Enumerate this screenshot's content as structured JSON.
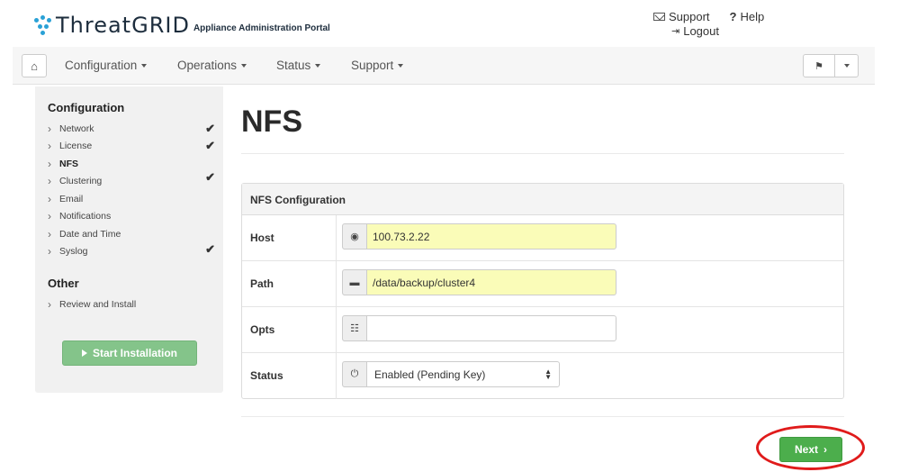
{
  "header": {
    "brand": "ThreatGRID",
    "brand_sub": "Appliance Administration Portal",
    "support_label": "Support",
    "help_label": "Help",
    "logout_label": "Logout"
  },
  "navbar": {
    "items": [
      {
        "label": "Configuration"
      },
      {
        "label": "Operations"
      },
      {
        "label": "Status"
      },
      {
        "label": "Support"
      }
    ]
  },
  "sidebar": {
    "section1_title": "Configuration",
    "items": [
      {
        "label": "Network",
        "checked": true
      },
      {
        "label": "License",
        "checked": true
      },
      {
        "label": "NFS",
        "checked": false,
        "active": true
      },
      {
        "label": "Clustering",
        "checked": true
      },
      {
        "label": "Email",
        "checked": false
      },
      {
        "label": "Notifications",
        "checked": false
      },
      {
        "label": "Date and Time",
        "checked": false
      },
      {
        "label": "Syslog",
        "checked": true
      }
    ],
    "section2_title": "Other",
    "other_items": [
      {
        "label": "Review and Install"
      }
    ],
    "start_button_label": "Start Installation"
  },
  "main": {
    "page_title": "NFS",
    "panel_title": "NFS Configuration",
    "fields": {
      "host": {
        "label": "Host",
        "value": "100.73.2.22",
        "icon": "globe-icon"
      },
      "path": {
        "label": "Path",
        "value": "/data/backup/cluster4",
        "icon": "folder-icon"
      },
      "opts": {
        "label": "Opts",
        "value": "",
        "icon": "options-icon"
      },
      "status": {
        "label": "Status",
        "value": "Enabled (Pending Key)",
        "icon": "power-icon"
      }
    },
    "next_button_label": "Next"
  },
  "colors": {
    "accent_green": "#4cae4c",
    "start_green": "#84c48a",
    "filled_input": "#fafcb8",
    "highlight_red": "#e01b1b"
  }
}
